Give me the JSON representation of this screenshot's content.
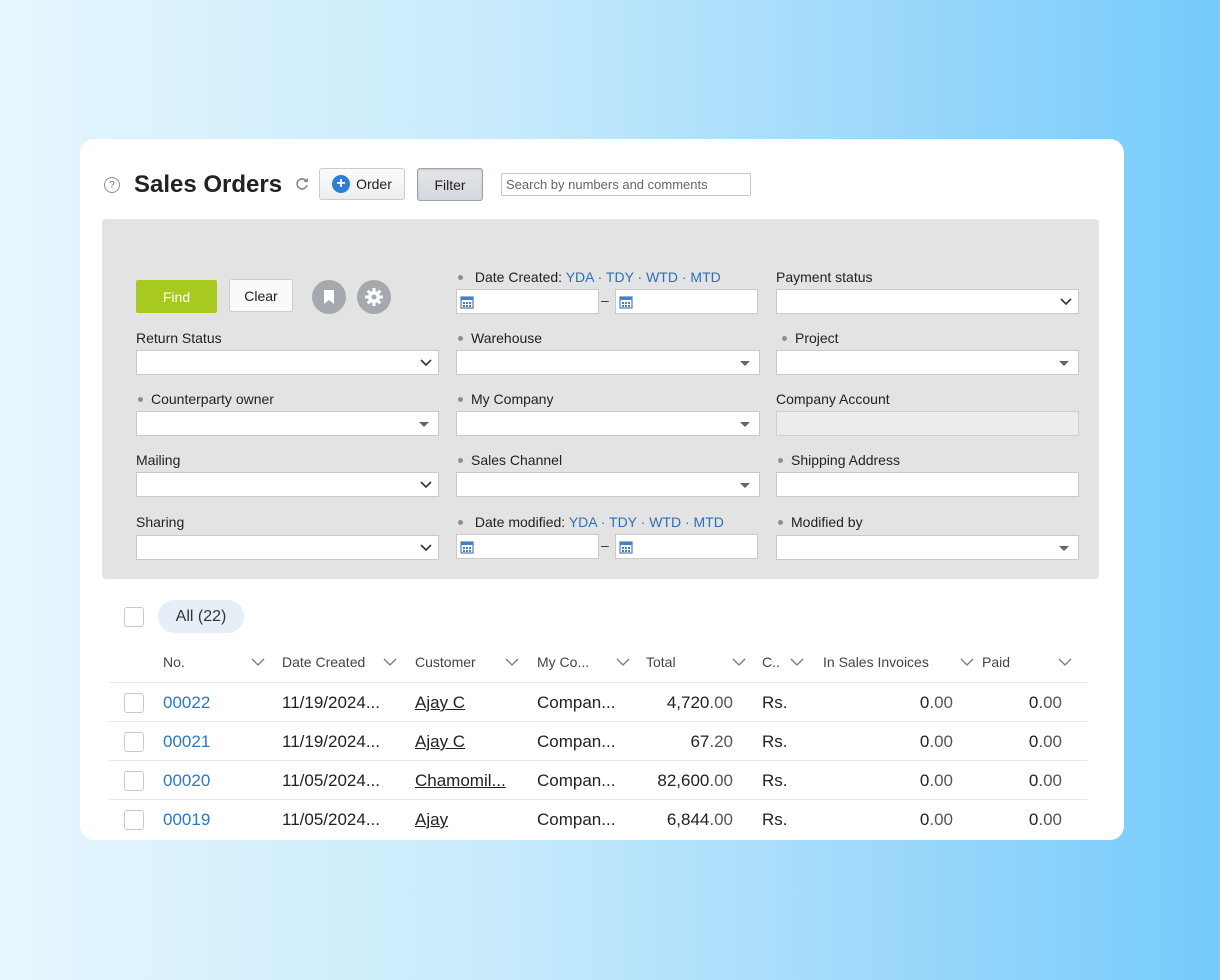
{
  "header": {
    "title": "Sales Orders",
    "order_button": "Order",
    "filter_button": "Filter",
    "search_placeholder": "Search by numbers and comments"
  },
  "filters": {
    "find_button": "Find",
    "clear_button": "Clear",
    "date_created": {
      "label": "Date Created:",
      "quick_links": "YDA · TDY · WTD · MTD"
    },
    "payment_status": "Payment status",
    "return_status": "Return Status",
    "warehouse": "Warehouse",
    "project": "Project",
    "counterparty_owner": "Counterparty owner",
    "my_company": "My Company",
    "company_account": "Company Account",
    "mailing": "Mailing",
    "sales_channel": "Sales Channel",
    "shipping_address": "Shipping Address",
    "sharing": "Sharing",
    "date_modified": {
      "label": "Date modified:",
      "quick_links": "YDA · TDY · WTD · MTD"
    },
    "modified_by": "Modified by",
    "range_dash": "–"
  },
  "table": {
    "all_chip": "All (22)",
    "columns": [
      "No.",
      "Date Created",
      "Customer",
      "My Co...",
      "Total",
      "C..",
      "In Sales Invoices",
      "Paid"
    ],
    "rows": [
      {
        "no": "00022",
        "date": "11/19/2024...",
        "customer": "Ajay C",
        "company": "Compan...",
        "total_int": "4,720",
        "total_dec": ".00",
        "currency": "Rs.",
        "invoices_int": "0",
        "invoices_dec": ".00",
        "paid_int": "0",
        "paid_dec": ".00"
      },
      {
        "no": "00021",
        "date": "11/19/2024...",
        "customer": "Ajay C",
        "company": "Compan...",
        "total_int": "67",
        "total_dec": ".20",
        "currency": "Rs.",
        "invoices_int": "0",
        "invoices_dec": ".00",
        "paid_int": "0",
        "paid_dec": ".00"
      },
      {
        "no": "00020",
        "date": "11/05/2024...",
        "customer": "Chamomil...",
        "company": "Compan...",
        "total_int": "82,600",
        "total_dec": ".00",
        "currency": "Rs.",
        "invoices_int": "0",
        "invoices_dec": ".00",
        "paid_int": "0",
        "paid_dec": ".00"
      },
      {
        "no": "00019",
        "date": "11/05/2024...",
        "customer": "Ajay",
        "company": "Compan...",
        "total_int": "6,844",
        "total_dec": ".00",
        "currency": "Rs.",
        "invoices_int": "0",
        "invoices_dec": ".00",
        "paid_int": "0",
        "paid_dec": ".00"
      }
    ]
  },
  "colors": {
    "find_green": "#a8c920",
    "link_blue": "#2b78c8",
    "panel_gray": "#e3e3e3",
    "order_icon_blue": "#2d7fd6"
  },
  "icons": [
    "help-icon",
    "refresh-icon",
    "plus-circle-icon",
    "bookmark-icon",
    "gear-icon",
    "calendar-icon",
    "chevron-down-icon"
  ]
}
